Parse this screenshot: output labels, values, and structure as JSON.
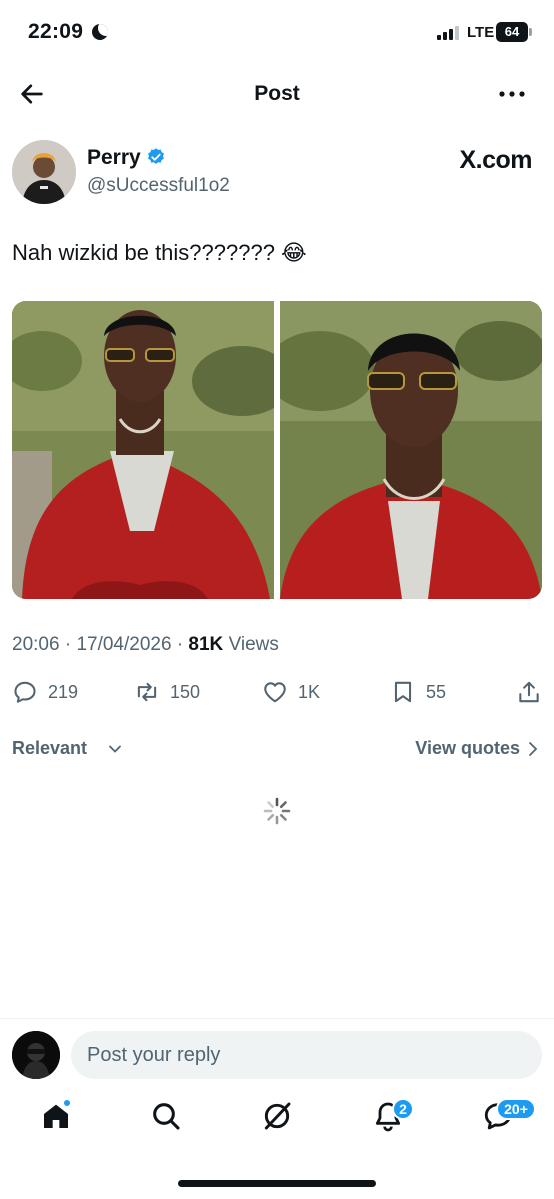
{
  "status_bar": {
    "time": "22:09",
    "network": "LTE",
    "battery": "64"
  },
  "header": {
    "title": "Post"
  },
  "post": {
    "display_name": "Perry",
    "handle": "@sUccessful1o2",
    "source": "X.com",
    "text": "Nah wizkid be this??????? 😂",
    "time": "20:06",
    "date": "17/04/2026",
    "views_count": "81K",
    "views_label": "Views"
  },
  "actions": {
    "replies": "219",
    "reposts": "150",
    "likes": "1K",
    "bookmarks": "55"
  },
  "replies_section": {
    "sort_label": "Relevant",
    "quotes_label": "View quotes"
  },
  "reply_box": {
    "placeholder": "Post your reply"
  },
  "tab_bar": {
    "notifications_badge": "2",
    "messages_badge": "20+"
  },
  "colors": {
    "accent": "#1d9bf0",
    "text": "#0f1419",
    "muted": "#536471"
  }
}
